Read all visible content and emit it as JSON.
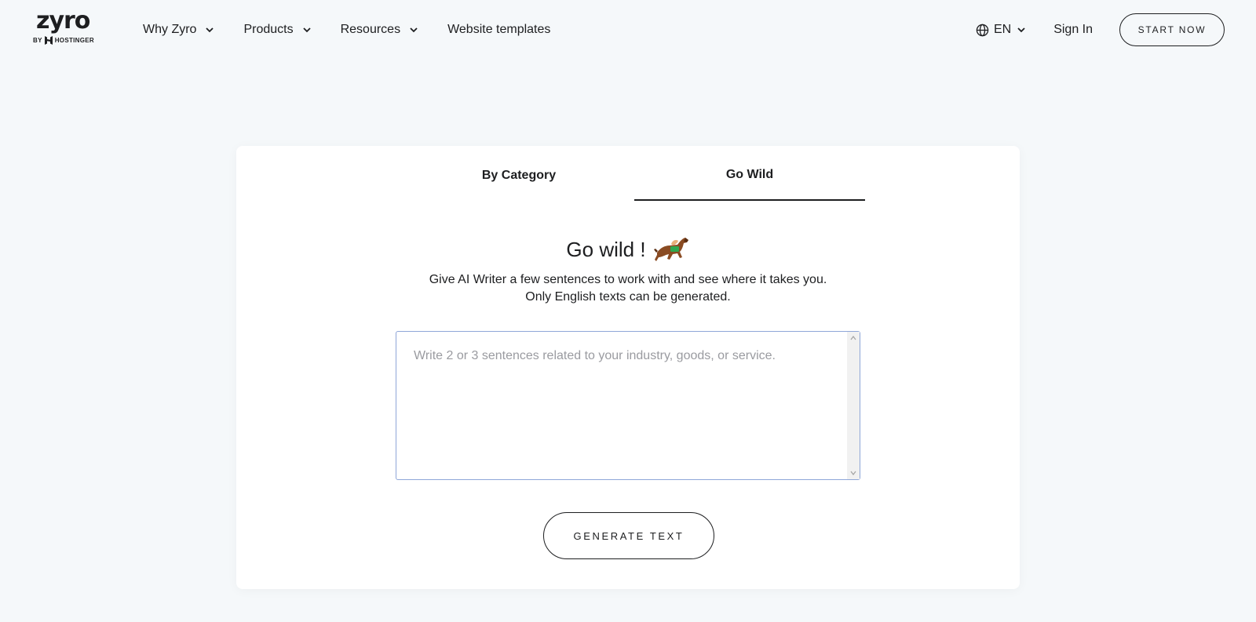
{
  "header": {
    "logo": {
      "word": "zyro",
      "by": "BY",
      "brand": "HOSTINGER"
    },
    "nav": [
      {
        "label": "Why Zyro",
        "dropdown": true
      },
      {
        "label": "Products",
        "dropdown": true
      },
      {
        "label": "Resources",
        "dropdown": true
      },
      {
        "label": "Website templates",
        "dropdown": false
      }
    ],
    "language": "EN",
    "sign_in": "Sign In",
    "start_now": "START NOW"
  },
  "card": {
    "tabs": [
      {
        "label": "By Category",
        "active": false
      },
      {
        "label": "Go Wild",
        "active": true
      }
    ],
    "heading": "Go wild !",
    "heading_icon": "horse-racing-icon",
    "description": [
      "Give AI Writer a few sentences to work with and see where it takes you.",
      "Only English texts can be generated."
    ],
    "input": {
      "value": "",
      "placeholder": "Write 2 or 3 sentences related to your industry, goods, or service."
    },
    "generate_button": "GENERATE TEXT"
  },
  "colors": {
    "background": "#f5f8fa",
    "card": "#ffffff",
    "text": "#1d1e20",
    "input_border": "#8fa6d8",
    "placeholder": "#9a9ba0"
  }
}
